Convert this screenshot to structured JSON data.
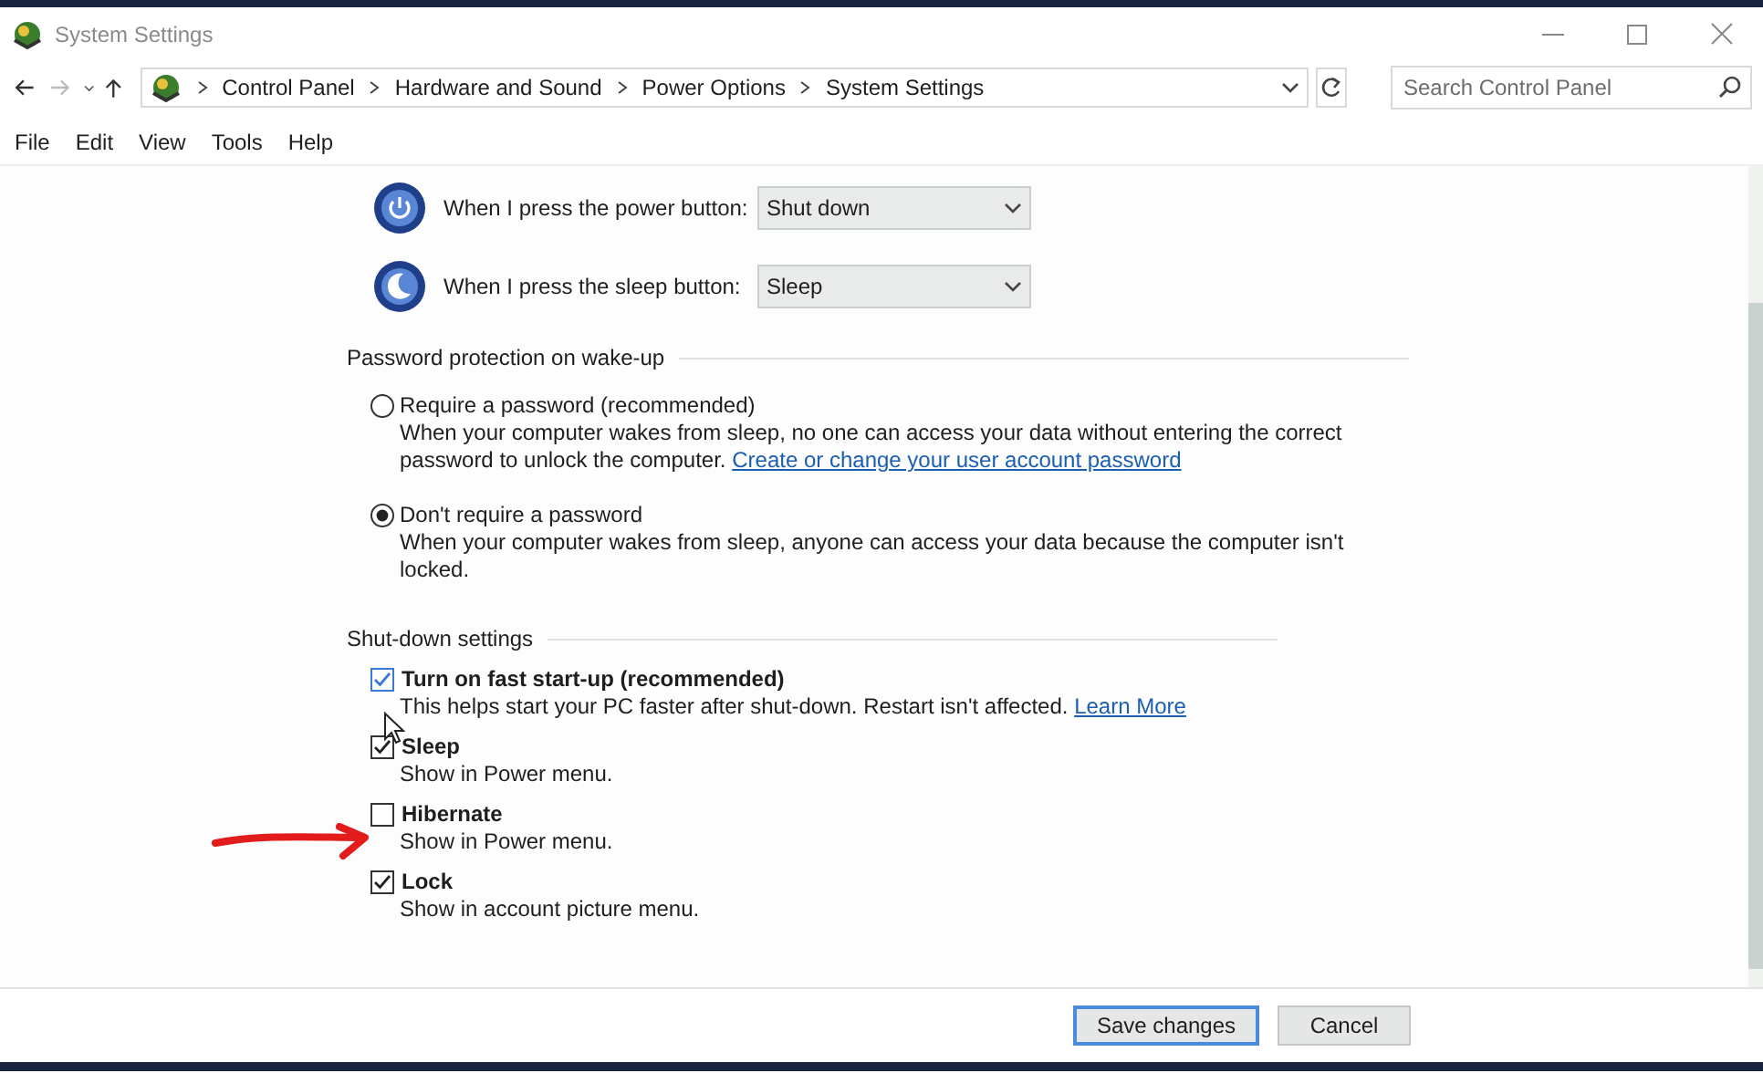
{
  "window": {
    "title": "System Settings"
  },
  "address_bar": {
    "breadcrumbs": [
      "Control Panel",
      "Hardware and Sound",
      "Power Options",
      "System Settings"
    ]
  },
  "search": {
    "placeholder": "Search Control Panel"
  },
  "menu": [
    "File",
    "Edit",
    "View",
    "Tools",
    "Help"
  ],
  "button_settings": [
    {
      "kind": "power",
      "label": "When I press the power button:",
      "value": "Shut down"
    },
    {
      "kind": "sleep",
      "label": "When I press the sleep button:",
      "value": "Sleep"
    }
  ],
  "password_section": {
    "title": "Password protection on wake-up",
    "options": [
      {
        "label": "Require a password (recommended)",
        "description": "When your computer wakes from sleep, no one can access your data without entering the correct password to unlock the computer.",
        "link": "Create or change your user account password",
        "selected": false
      },
      {
        "label": "Don't require a password",
        "description": "When your computer wakes from sleep, anyone can access your data because the computer isn't locked.",
        "selected": true
      }
    ]
  },
  "shutdown_section": {
    "title": "Shut-down settings",
    "options": [
      {
        "label": "Turn on fast start-up (recommended)",
        "description": "This helps start your PC faster after shut-down. Restart isn't affected.",
        "link": "Learn More",
        "checked": true,
        "focused": true
      },
      {
        "label": "Sleep",
        "description": "Show in Power menu.",
        "checked": true,
        "focused": false
      },
      {
        "label": "Hibernate",
        "description": "Show in Power menu.",
        "checked": false,
        "focused": false
      },
      {
        "label": "Lock",
        "description": "Show in account picture menu.",
        "checked": true,
        "focused": false
      }
    ]
  },
  "footer_buttons": [
    {
      "label": "Save changes",
      "default": true
    },
    {
      "label": "Cancel",
      "default": false
    }
  ]
}
